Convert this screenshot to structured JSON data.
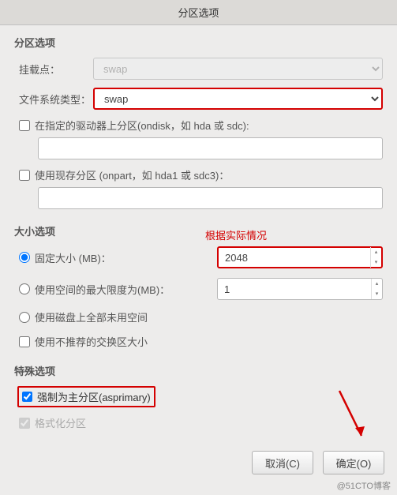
{
  "window_title": "分区选项",
  "sections": {
    "partition": {
      "title": "分区选项",
      "mount_point_label": "挂载点：",
      "mount_point_value": "swap",
      "fs_type_label": "文件系统类型：",
      "fs_type_value": "swap",
      "ondisk_label": "在指定的驱动器上分区(ondisk，如 hda 或 sdc):",
      "ondisk_value": "",
      "onpart_label": "使用现存分区 (onpart，如 hda1 或 sdc3)：",
      "onpart_value": ""
    },
    "size": {
      "title": "大小选项",
      "fixed_label": "固定大小 (MB)：",
      "fixed_value": "2048",
      "grow_label": "使用空间的最大限度为(MB)：",
      "grow_value": "1",
      "fill_label": "使用磁盘上全部未用空间",
      "recommended_label": "使用不推荐的交换区大小"
    },
    "special": {
      "title": "特殊选项",
      "asprimary_label": "强制为主分区(asprimary)",
      "format_label": "格式化分区"
    }
  },
  "annotation": "根据实际情况",
  "buttons": {
    "cancel": "取消(C)",
    "ok": "确定(O)"
  },
  "watermark": "@51CTO博客"
}
